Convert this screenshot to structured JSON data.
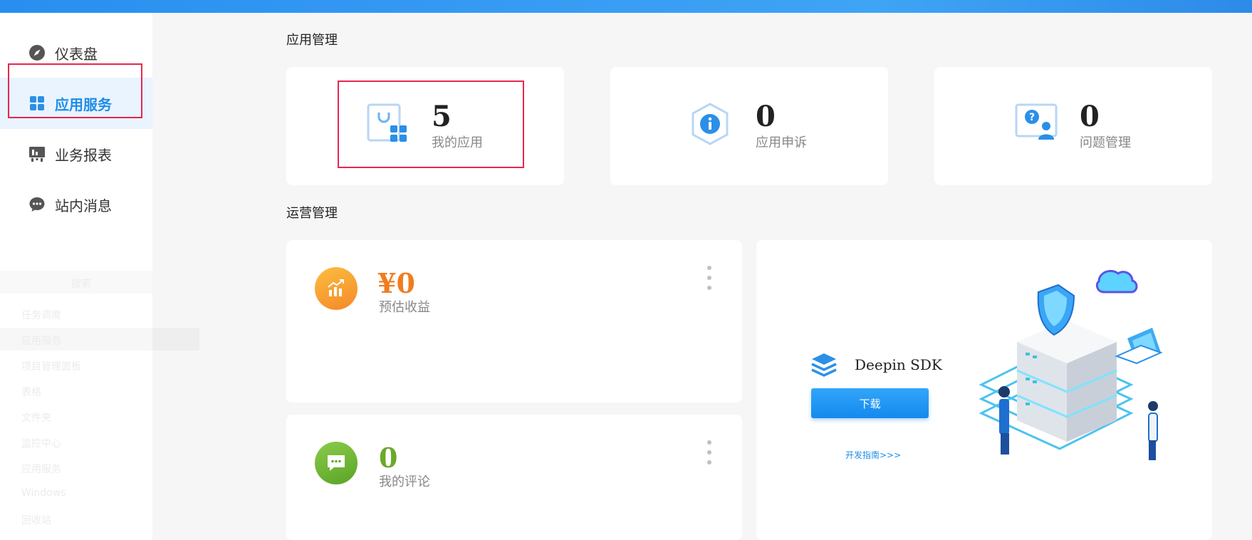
{
  "sidebar": {
    "items": [
      {
        "label": "仪表盘",
        "icon": "dashboard-icon"
      },
      {
        "label": "应用服务",
        "icon": "grid-apps-icon",
        "active": true
      },
      {
        "label": "业务报表",
        "icon": "report-icon"
      },
      {
        "label": "站内消息",
        "icon": "message-icon"
      }
    ],
    "ghost_items": [
      "搜索",
      "任务调度",
      "应用服务",
      "项目管理面板",
      "表格",
      "文件夹",
      "监控中心",
      "应用服务",
      "Windows",
      "回收站"
    ]
  },
  "main": {
    "app_section_title": "应用管理",
    "stats": [
      {
        "value": "5",
        "label": "我的应用",
        "icon": "my-apps-icon"
      },
      {
        "value": "0",
        "label": "应用申诉",
        "icon": "appeal-info-icon"
      },
      {
        "value": "0",
        "label": "问题管理",
        "icon": "question-user-icon"
      }
    ],
    "ops_section_title": "运营管理",
    "revenue": {
      "value": "¥0",
      "label": "预估收益",
      "color": "#f07d1e",
      "icon": "bar-chart-icon"
    },
    "comments": {
      "value": "0",
      "label": "我的评论",
      "color": "#6aaa2a",
      "icon": "chat-bubble-icon"
    },
    "sdk": {
      "title": "Deepin SDK",
      "download_label": "下载",
      "guide_label": "开发指南>>>",
      "icon": "layers-icon",
      "illustration": "server-security-illustration"
    }
  },
  "colors": {
    "accent": "#1e8de6",
    "highlight": "#e8264f",
    "topbar": "#2a8ef0"
  }
}
